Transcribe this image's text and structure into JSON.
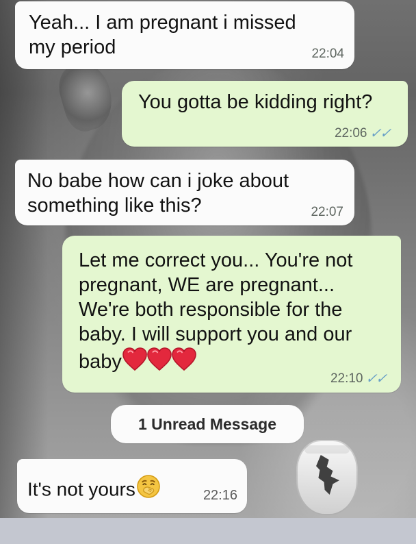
{
  "messages": [
    {
      "text": "Yeah... I am pregnant i missed\nmy period",
      "time": "22:04"
    },
    {
      "text": "You gotta be kidding right?",
      "time": "22:06",
      "receipt": "✓✓"
    },
    {
      "text": "No babe how can i joke about\nsomething like this?",
      "time": "22:07"
    },
    {
      "text": "Let me correct you... You're not\npregnant, WE are pregnant...\nWe're both responsible for the\nbaby. I will support you and our\nbaby",
      "time": "22:10",
      "receipt": "✓✓",
      "emoji": [
        "red-heart-icon",
        "red-heart-icon",
        "red-heart-icon"
      ]
    },
    {
      "text": "It's not yours",
      "time": "22:16",
      "emoji": [
        "face-with-hand-over-mouth-icon"
      ]
    }
  ],
  "unread": {
    "label": "1 Unread Message"
  },
  "colors": {
    "incoming_bubble": "#fbfbfb",
    "outgoing_bubble": "#e4f7d0",
    "read_receipt": "#6aa1c7",
    "bottom_bar": "#c4c7d0"
  }
}
